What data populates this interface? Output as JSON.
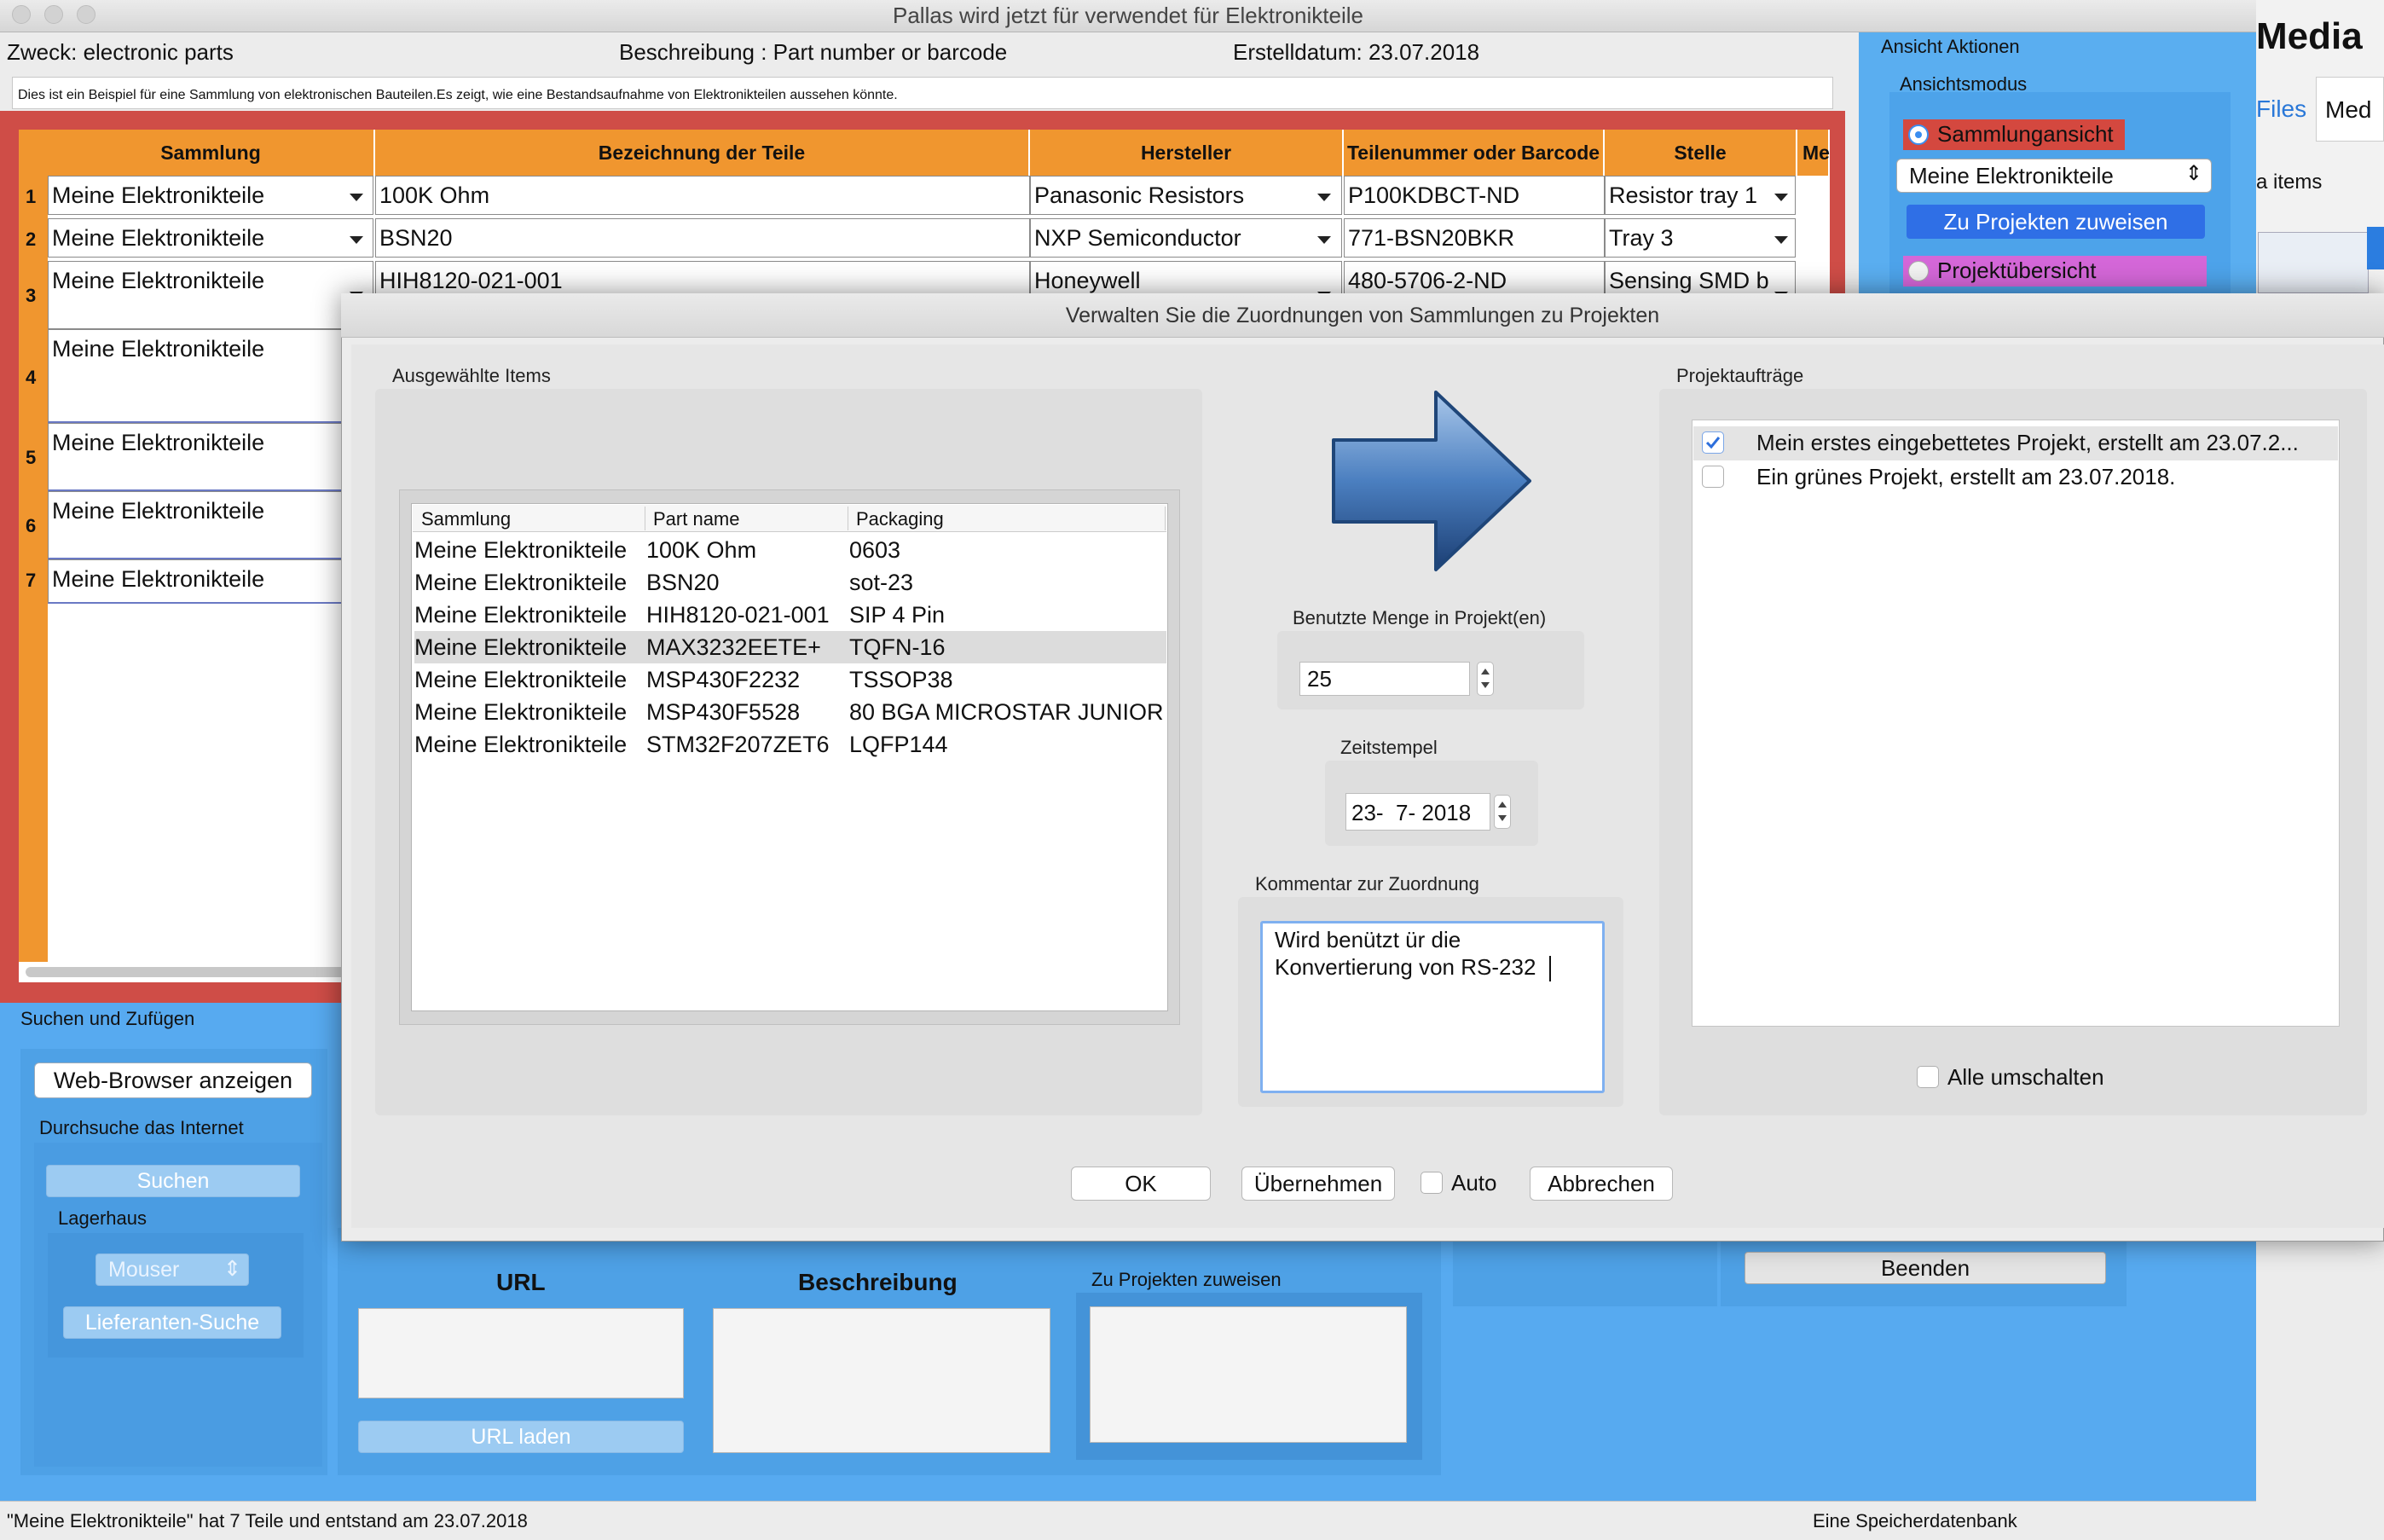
{
  "window": {
    "title": "Pallas wird jetzt für verwendet für Elektronikteile"
  },
  "header": {
    "zweck": "Zweck: electronic parts",
    "beschreibung": "Beschreibung : Part number or barcode",
    "erstelldatum": "Erstelldatum: 23.07.2018",
    "info": "Dies ist ein Beispiel für eine Sammlung von elektronischen Bauteilen.Es zeigt, wie eine Bestandsaufnahme von Elektronikteilen aussehen könnte."
  },
  "table": {
    "headers": [
      "Sammlung",
      "Bezeichnung der Teile",
      "Hersteller",
      "Teilenummer oder Barcode",
      "Stelle",
      "Me"
    ],
    "row_numbers": [
      "1",
      "2",
      "3",
      "4",
      "5",
      "6",
      "7"
    ],
    "rows": [
      {
        "sammlung": "Meine Elektronikteile",
        "bezeichnung": "100K Ohm",
        "hersteller": "Panasonic Resistors",
        "teilenummer": "P100KDBCT-ND",
        "stelle": "Resistor tray 1"
      },
      {
        "sammlung": "Meine Elektronikteile",
        "bezeichnung": "BSN20",
        "hersteller": "NXP Semiconductor",
        "teilenummer": "771-BSN20BKR",
        "stelle": "Tray 3"
      },
      {
        "sammlung": "Meine Elektronikteile",
        "bezeichnung": "HIH8120-021-001",
        "hersteller": "Honeywell",
        "teilenummer": "480-5706-2-ND",
        "stelle": "Sensing SMD b"
      },
      {
        "sammlung": "Meine Elektronikteile"
      },
      {
        "sammlung": "Meine Elektronikteile"
      },
      {
        "sammlung": "Meine Elektronikteile"
      },
      {
        "sammlung": "Meine Elektronikteile"
      }
    ]
  },
  "right_panel": {
    "title": "Ansicht Aktionen",
    "mode_label": "Ansichtsmodus",
    "radio_collection": "Sammlungansicht",
    "collection_select": "Meine Elektronikteile",
    "assign_button": "Zu Projekten zuweisen",
    "radio_projects": "Projektübersicht",
    "behind_media": "Media",
    "behind_files": "Files",
    "behind_med": "Med",
    "behind_items": "a items"
  },
  "bottom": {
    "search_title": "Suchen und Zufügen",
    "web_browser_button": "Web-Browser anzeigen",
    "internet_label": "Durchsuche das Internet",
    "search_button": "Suchen",
    "warehouse_label": "Lagerhaus",
    "warehouse_select": "Mouser",
    "supplier_button": "Lieferanten-Suche",
    "url_label": "URL",
    "url_button": "URL laden",
    "description_label": "Beschreibung",
    "assign_label": "Zu Projekten zuweisen",
    "quit_button": "Beenden"
  },
  "status": {
    "left": "\"Meine Elektronikteile\" hat 7 Teile  und entstand am 23.07.2018",
    "right": "Eine Speicherdatenbank"
  },
  "dialog": {
    "title": "Verwalten Sie die Zuordnungen von Sammlungen zu Projekten",
    "selected_label": "Ausgewählte Items",
    "columns": [
      "Sammlung",
      "Part name",
      "Packaging"
    ],
    "items": [
      {
        "sammlung": "Meine Elektronikteile",
        "part": "100K Ohm",
        "packaging": "0603"
      },
      {
        "sammlung": "Meine Elektronikteile",
        "part": "BSN20",
        "packaging": "sot-23"
      },
      {
        "sammlung": "Meine Elektronikteile",
        "part": "HIH8120-021-001",
        "packaging": "SIP 4 Pin"
      },
      {
        "sammlung": "Meine Elektronikteile",
        "part": "MAX3232EETE+",
        "packaging": "TQFN-16"
      },
      {
        "sammlung": "Meine Elektronikteile",
        "part": "MSP430F2232",
        "packaging": "TSSOP38"
      },
      {
        "sammlung": "Meine Elektronikteile",
        "part": "MSP430F5528",
        "packaging": "80 BGA MICROSTAR JUNIOR"
      },
      {
        "sammlung": "Meine Elektronikteile",
        "part": "STM32F207ZET6",
        "packaging": "LQFP144"
      }
    ],
    "quantity_label": "Benutzte Menge in Projekt(en)",
    "quantity_value": "25",
    "timestamp_label": "Zeitstempel",
    "timestamp_value": "23-  7- 2018",
    "comment_label": "Kommentar zur Zuordnung",
    "comment_line1": "Wird benützt ür die",
    "comment_line2": "Konvertierung von RS-232",
    "projects_label": "Projektaufträge",
    "projects": [
      {
        "label": "Mein erstes eingebettetes Projekt, erstellt am 23.07.2...",
        "checked": true
      },
      {
        "label": "Ein grünes Projekt, erstellt am 23.07.2018.",
        "checked": false
      }
    ],
    "toggle_all": "Alle umschalten",
    "ok": "OK",
    "apply": "Übernehmen",
    "auto": "Auto",
    "cancel": "Abbrechen"
  }
}
